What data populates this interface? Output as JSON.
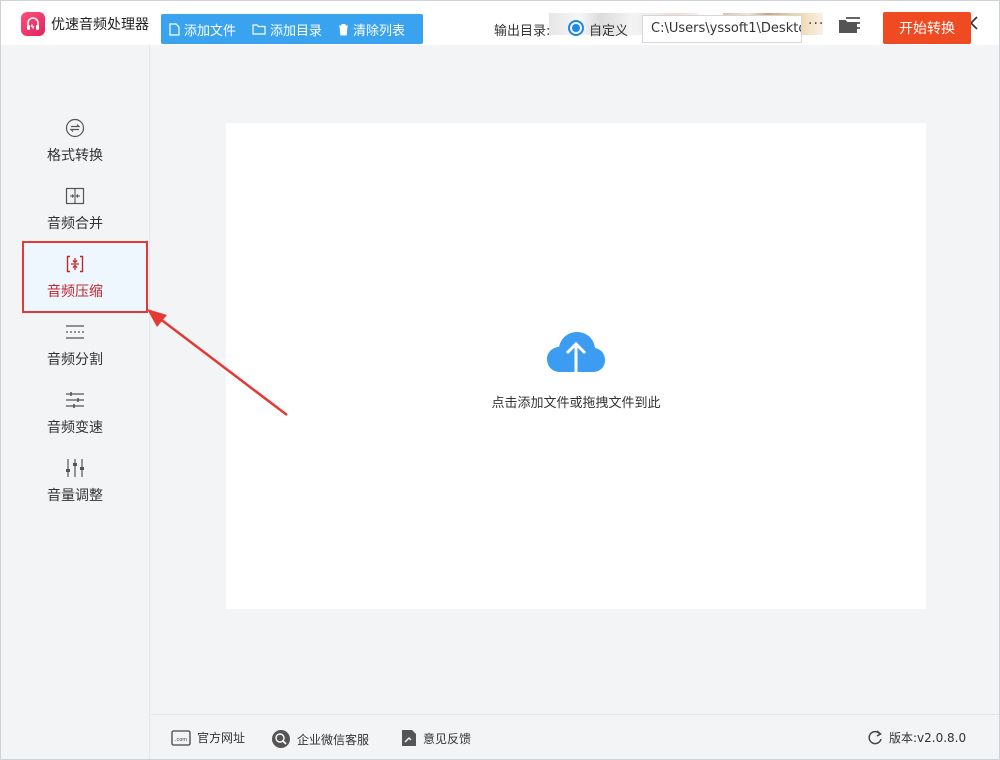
{
  "app": {
    "title": "优速音频处理器",
    "accent": "#3aa3f0",
    "highlight": "#e53935"
  },
  "window_controls": [
    "menu-icon",
    "minimize-icon",
    "maximize-icon",
    "close-icon"
  ],
  "sidebar": {
    "items": [
      {
        "label": "格式转换",
        "icon": "convert-icon",
        "active": false
      },
      {
        "label": "音频合并",
        "icon": "merge-icon",
        "active": false
      },
      {
        "label": "音频压缩",
        "icon": "compress-icon",
        "active": true
      },
      {
        "label": "音频分割",
        "icon": "split-icon",
        "active": false
      },
      {
        "label": "音频变速",
        "icon": "speed-icon",
        "active": false
      },
      {
        "label": "音量调整",
        "icon": "volume-icon",
        "active": false
      }
    ]
  },
  "toolbar": {
    "add_file": "添加文件",
    "add_folder": "添加目录",
    "clear_list": "清除列表",
    "output_label": "输出目录:",
    "custom_label": "自定义",
    "output_path": "C:\\Users\\yssoft1\\Deskto",
    "more": "···",
    "start": "开始转换"
  },
  "dropzone": {
    "hint": "点击添加文件或拖拽文件到此"
  },
  "footer": {
    "website": "官方网址",
    "wechat": "企业微信客服",
    "feedback": "意见反馈",
    "version": "版本:v2.0.8.0"
  }
}
